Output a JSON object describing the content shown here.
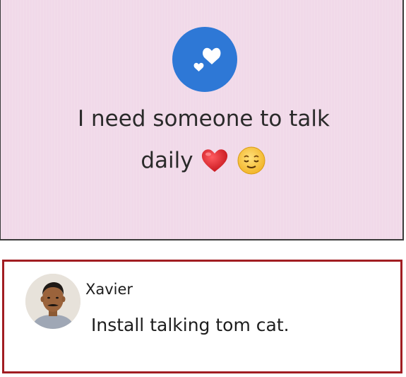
{
  "post": {
    "badge_icon": "hearts-icon",
    "text_line_1": "I need someone to talk",
    "text_line_2": "daily",
    "emojis": [
      "red-heart-emoji",
      "relieved-face-emoji"
    ],
    "background_color": "#f1d9e9",
    "badge_color": "#2e78d6"
  },
  "comment": {
    "author": "Xavier",
    "text": "Install talking tom cat.",
    "highlight_border_color": "#a11d22"
  }
}
